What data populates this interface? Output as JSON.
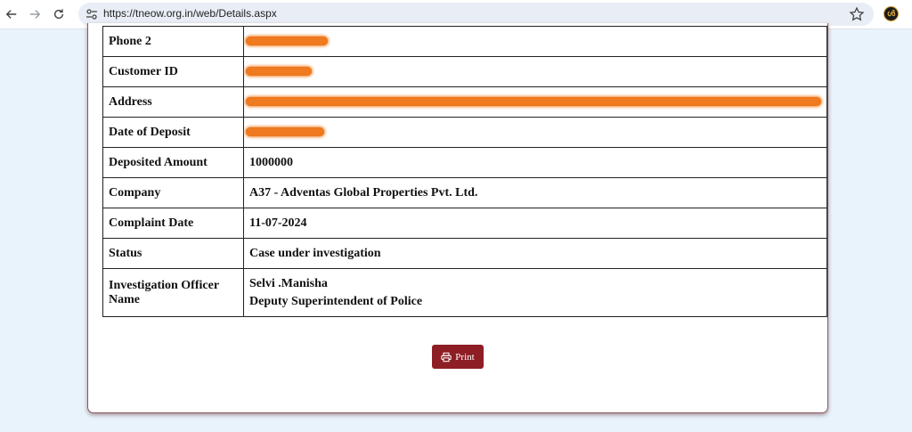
{
  "browser": {
    "url": "https://tneow.org.in/web/Details.aspx"
  },
  "details": [
    {
      "label": "Phone 2",
      "value": "",
      "redacted": true
    },
    {
      "label": "Customer ID",
      "value": "",
      "redacted": true
    },
    {
      "label": "Address",
      "value": "",
      "redacted": true
    },
    {
      "label": "Date of Deposit",
      "value": "",
      "redacted": true
    },
    {
      "label": "Deposited Amount",
      "value": "1000000"
    },
    {
      "label": "Company",
      "value": "A37 - Adventas Global Properties Pvt. Ltd."
    },
    {
      "label": "Complaint Date",
      "value": "11-07-2024"
    },
    {
      "label": "Status",
      "value": "Case under investigation"
    },
    {
      "label": "Investigation Officer Name",
      "value_lines": [
        "Selvi .Manisha",
        "Deputy Superintendent of Police"
      ]
    }
  ],
  "print_button": {
    "label": "Print",
    "icon": "printer-icon"
  },
  "colors": {
    "print_button": "#8e1e25",
    "page_background": "#e8f3fc",
    "redaction": "#ef7a1f"
  }
}
